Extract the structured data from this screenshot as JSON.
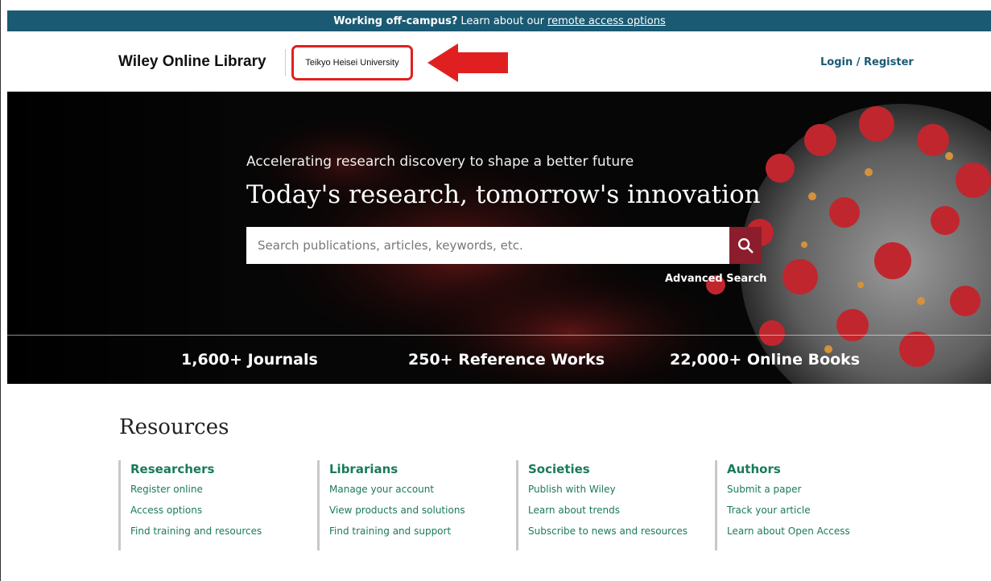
{
  "banner": {
    "strong": "Working off-campus?",
    "text": "Learn about our",
    "link": "remote access options"
  },
  "header": {
    "logo": "Wiley Online Library",
    "institution": "Teikyo Heisei University",
    "login": "Login / Register"
  },
  "hero": {
    "tagline": "Accelerating research discovery to shape a better future",
    "headline": "Today's research, tomorrow's innovation",
    "search": {
      "placeholder": "Search publications, articles, keywords, etc."
    },
    "advanced_search": "Advanced Search",
    "stats": [
      "1,600+ Journals",
      "250+ Reference Works",
      "22,000+ Online Books"
    ]
  },
  "resources": {
    "title": "Resources",
    "columns": [
      {
        "title": "Researchers",
        "links": [
          "Register online",
          "Access options",
          "Find training and resources"
        ]
      },
      {
        "title": "Librarians",
        "links": [
          "Manage your account",
          "View products and solutions",
          "Find training and support"
        ]
      },
      {
        "title": "Societies",
        "links": [
          "Publish with Wiley",
          "Learn about trends",
          "Subscribe to news and resources"
        ]
      },
      {
        "title": "Authors",
        "links": [
          "Submit a paper",
          "Track your article",
          "Learn about Open Access"
        ]
      }
    ]
  },
  "colors": {
    "banner": "#1a5a73",
    "accent_green": "#1a7a5a",
    "search_button": "#8b1d2c",
    "highlight_red": "#e02020"
  },
  "icons": {
    "search": "search-icon",
    "arrow": "arrow-left-icon"
  }
}
